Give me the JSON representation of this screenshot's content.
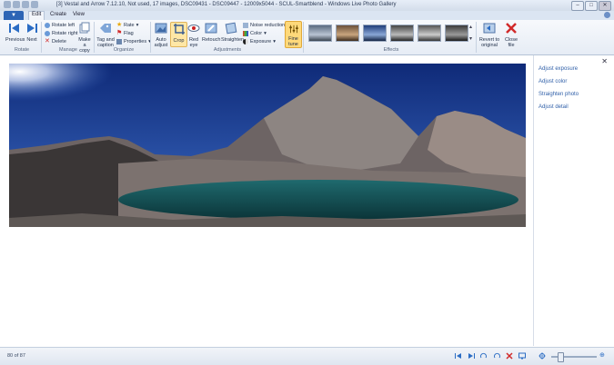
{
  "window": {
    "title": "[3] Vestal and Arrow 7.12.10, Not used, 17 images, DSC09431 - DSC09447 - 12009x5044 - SCUL-Smartblend - Windows Live Photo Gallery"
  },
  "tabs": [
    {
      "label": "Edit",
      "active": true
    },
    {
      "label": "Create",
      "active": false
    },
    {
      "label": "View",
      "active": false
    }
  ],
  "ribbon": {
    "rotate": {
      "previous": "Previous",
      "next": "Next",
      "group": "Rotate"
    },
    "manage": {
      "rotate_left": "Rotate left",
      "rotate_right": "Rotate right",
      "delete": "Delete",
      "make_copy": "Make a copy",
      "group": "Manage"
    },
    "organize": {
      "tag_caption": "Tag and caption",
      "rate": "Rate",
      "flag": "Flag",
      "properties": "Properties",
      "group": "Organize"
    },
    "adjustments": {
      "auto_adjust": "Auto adjust",
      "crop": "Crop",
      "red_eye": "Red eye",
      "retouch": "Retouch",
      "straighten": "Straighten",
      "noise": "Noise reduction",
      "color": "Color",
      "exposure": "Exposure",
      "group": "Adjustments"
    },
    "fine_tune": "Fine tune",
    "effects": {
      "group": "Effects"
    },
    "revert": "Revert to original",
    "close_file": "Close file"
  },
  "pane": {
    "items": [
      "Adjust exposure",
      "Adjust color",
      "Straighten photo",
      "Adjust detail"
    ]
  },
  "status": {
    "position": "80 of 87"
  },
  "colors": {
    "accent": "#2d65b5",
    "fine_tune": "#ffd97a"
  }
}
